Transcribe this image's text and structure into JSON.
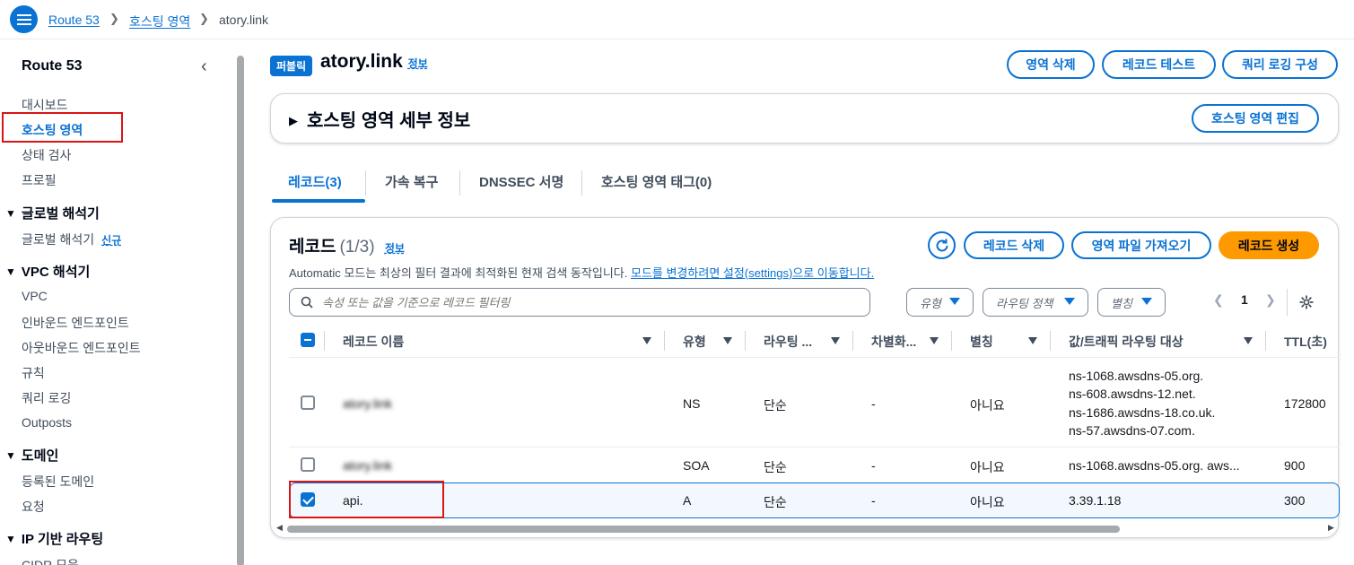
{
  "breadcrumb": {
    "items": [
      "Route 53",
      "호스팅 영역"
    ],
    "current": "atory.link"
  },
  "sidebar": {
    "title": "Route 53",
    "items_top": [
      "대시보드",
      "호스팅 영역",
      "상태 검사",
      "프로필"
    ],
    "groups": [
      {
        "label": "글로벌 해석기",
        "items": [
          "글로벌 해석기"
        ],
        "new_badge": "신규"
      },
      {
        "label": "VPC 해석기",
        "items": [
          "VPC",
          "인바운드 엔드포인트",
          "아웃바운드 엔드포인트",
          "규칙",
          "쿼리 로깅",
          "Outposts"
        ]
      },
      {
        "label": "도메인",
        "items": [
          "등록된 도메인",
          "요청"
        ]
      },
      {
        "label": "IP 기반 라우팅",
        "items": [
          "CIDR 모음"
        ]
      }
    ]
  },
  "zone": {
    "badge": "퍼블릭",
    "name": "atory.link",
    "info": "정보"
  },
  "header_buttons": {
    "delete_zone": "영역 삭제",
    "test_record": "레코드 테스트",
    "query_logging": "쿼리 로깅 구성"
  },
  "details": {
    "title": "호스팅 영역 세부 정보",
    "edit_button": "호스팅 영역 편집"
  },
  "tabs": [
    "레코드(3)",
    "가속 복구",
    "DNSSEC 서명",
    "호스팅 영역 태그(0)"
  ],
  "records": {
    "title": "레코드",
    "count": "(1/3)",
    "info": "정보",
    "desc_prefix": "Automatic 모드는 최상의 필터 결과에 최적화된 현재 검색 동작입니다.",
    "desc_link": "모드를 변경하려면 설정(settings)으로 이동합니다.",
    "buttons": {
      "delete": "레코드 삭제",
      "import": "영역 파일 가져오기",
      "create": "레코드 생성"
    },
    "search_placeholder": "속성 또는 값을 기준으로 레코드 필터링",
    "filters": {
      "type": "유형",
      "routing": "라우팅 정책",
      "alias": "별칭"
    },
    "page": "1",
    "columns": [
      "레코드 이름",
      "유형",
      "라우팅 ...",
      "차별화...",
      "별칭",
      "값/트래픽 라우팅 대상",
      "TTL(초)"
    ],
    "rows": [
      {
        "name": "atory.link",
        "type": "NS",
        "routing": "단순",
        "diff": "-",
        "alias": "아니요",
        "values": [
          "ns-1068.awsdns-05.org.",
          "ns-608.awsdns-12.net.",
          "ns-1686.awsdns-18.co.uk.",
          "ns-57.awsdns-07.com."
        ],
        "ttl": "172800",
        "checked": false
      },
      {
        "name": "atory.link",
        "type": "SOA",
        "routing": "단순",
        "diff": "-",
        "alias": "아니요",
        "values": [
          "ns-1068.awsdns-05.org. aws..."
        ],
        "ttl": "900",
        "checked": false
      },
      {
        "name": "api.",
        "type": "A",
        "routing": "단순",
        "diff": "-",
        "alias": "아니요",
        "values": [
          "3.39.1.18"
        ],
        "ttl": "300",
        "checked": true
      }
    ]
  },
  "colors": {
    "accent": "#0972d3",
    "primary_button": "#ff9900",
    "highlight": "#d91515"
  }
}
